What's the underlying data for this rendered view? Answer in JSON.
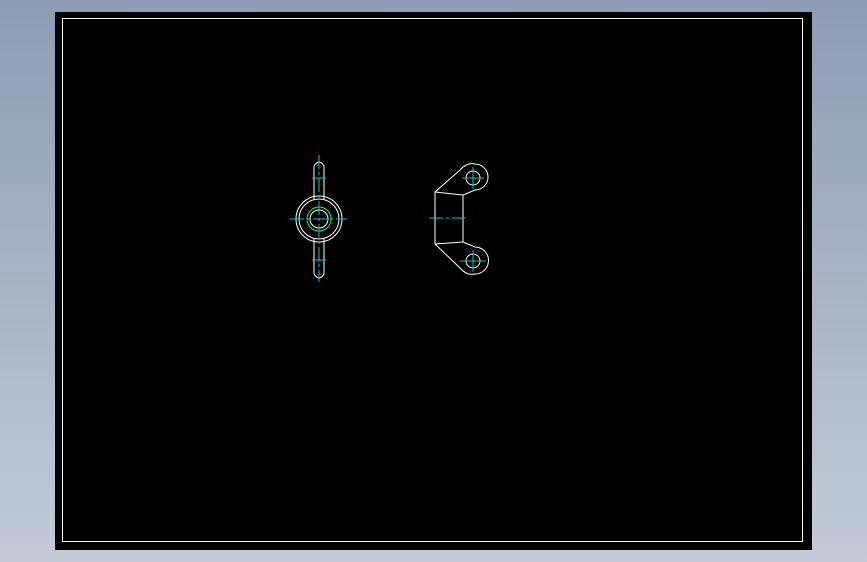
{
  "background": {
    "gradient_top": "#8e9bb2",
    "gradient_bottom": "#c3cbd7"
  },
  "sheet": {
    "fill": "#000000",
    "border_color": "#ffffff"
  },
  "colors": {
    "outline": "#ffffff",
    "centerline": "#00c8c8",
    "hidden": "#00ff66"
  },
  "views": [
    {
      "id": "front-view",
      "part": "wing-nut",
      "projection": "front"
    },
    {
      "id": "side-view",
      "part": "wing-nut",
      "projection": "side"
    }
  ]
}
